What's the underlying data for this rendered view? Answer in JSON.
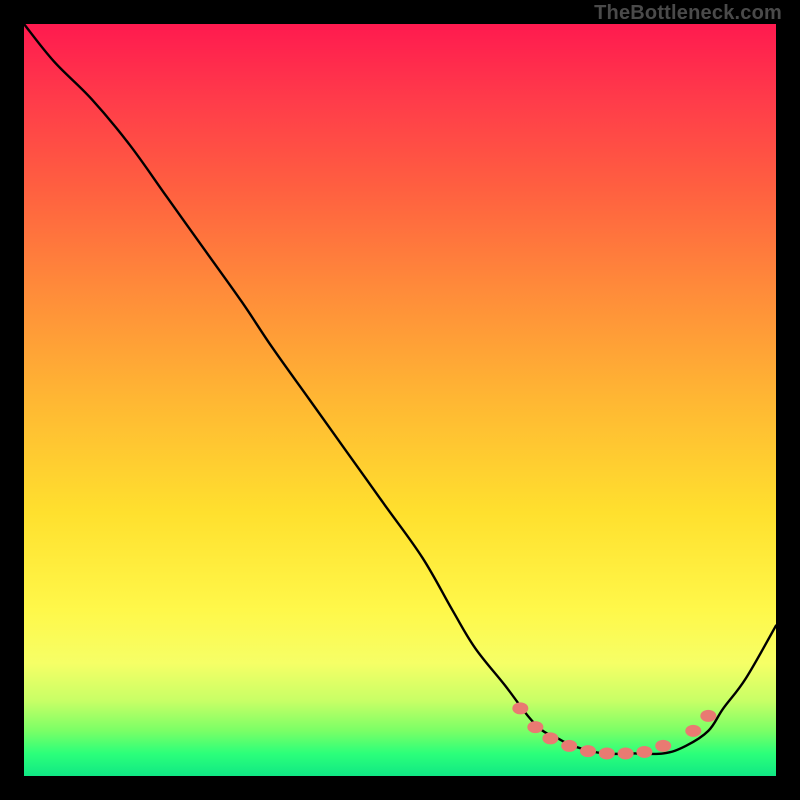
{
  "watermark": "TheBottleneck.com",
  "chart_data": {
    "type": "line",
    "title": "",
    "xlabel": "",
    "ylabel": "",
    "xlim": [
      0,
      100
    ],
    "ylim": [
      0,
      100
    ],
    "series": [
      {
        "name": "bottleneck-curve",
        "x": [
          0,
          4,
          9,
          14,
          19,
          24,
          29,
          33,
          38,
          43,
          48,
          53,
          57,
          60,
          64,
          67,
          69,
          71,
          73,
          77,
          81,
          85,
          88,
          91,
          93,
          96,
          100
        ],
        "y": [
          100,
          95,
          90,
          84,
          77,
          70,
          63,
          57,
          50,
          43,
          36,
          29,
          22,
          17,
          12,
          8,
          6,
          5,
          4,
          3,
          3,
          3,
          4,
          6,
          9,
          13,
          20
        ]
      }
    ],
    "markers": {
      "name": "highlight-dots",
      "color": "#e97a72",
      "points": [
        {
          "x": 66,
          "y": 9
        },
        {
          "x": 68,
          "y": 6.5
        },
        {
          "x": 70,
          "y": 5
        },
        {
          "x": 72.5,
          "y": 4
        },
        {
          "x": 75,
          "y": 3.3
        },
        {
          "x": 77.5,
          "y": 3
        },
        {
          "x": 80,
          "y": 3
        },
        {
          "x": 82.5,
          "y": 3.2
        },
        {
          "x": 85,
          "y": 4
        },
        {
          "x": 89,
          "y": 6
        },
        {
          "x": 91,
          "y": 8
        }
      ]
    }
  },
  "colors": {
    "curve_stroke": "#000000",
    "marker_fill": "#e97a72",
    "frame_bg": "#000000"
  }
}
